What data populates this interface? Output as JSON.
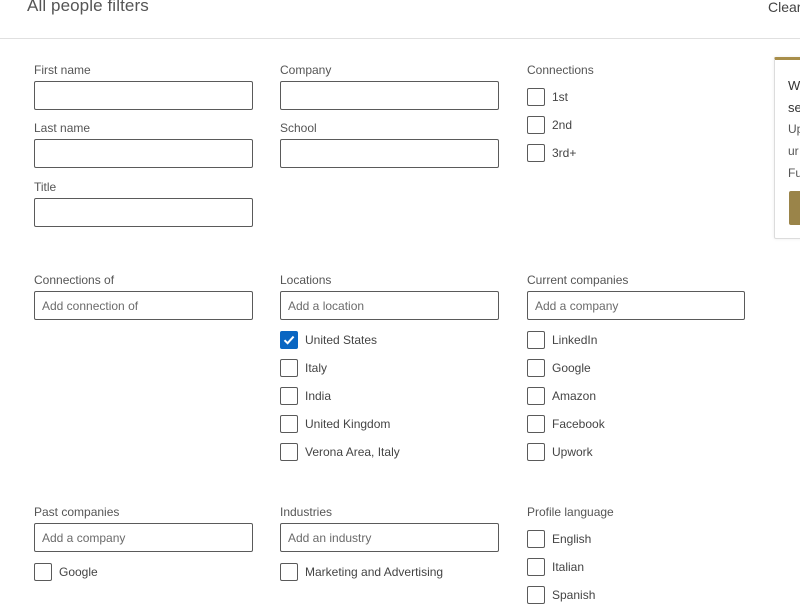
{
  "header": {
    "title": "All people filters",
    "clear_label": "Clear"
  },
  "fields": {
    "first_name": {
      "label": "First name",
      "value": ""
    },
    "last_name": {
      "label": "Last name",
      "value": ""
    },
    "title": {
      "label": "Title",
      "value": ""
    },
    "company": {
      "label": "Company",
      "value": ""
    },
    "school": {
      "label": "School",
      "value": ""
    }
  },
  "connections": {
    "label": "Connections",
    "options": [
      {
        "label": "1st",
        "checked": false
      },
      {
        "label": "2nd",
        "checked": false
      },
      {
        "label": "3rd+",
        "checked": false
      }
    ]
  },
  "connections_of": {
    "label": "Connections of",
    "placeholder": "Add connection of"
  },
  "locations": {
    "label": "Locations",
    "placeholder": "Add a location",
    "options": [
      {
        "label": "United States",
        "checked": true
      },
      {
        "label": "Italy",
        "checked": false
      },
      {
        "label": "India",
        "checked": false
      },
      {
        "label": "United Kingdom",
        "checked": false
      },
      {
        "label": "Verona Area, Italy",
        "checked": false
      }
    ]
  },
  "current_companies": {
    "label": "Current companies",
    "placeholder": "Add a company",
    "options": [
      {
        "label": "LinkedIn",
        "checked": false
      },
      {
        "label": "Google",
        "checked": false
      },
      {
        "label": "Amazon",
        "checked": false
      },
      {
        "label": "Facebook",
        "checked": false
      },
      {
        "label": "Upwork",
        "checked": false
      }
    ]
  },
  "past_companies": {
    "label": "Past companies",
    "placeholder": "Add a company",
    "options": [
      {
        "label": "Google",
        "checked": false
      }
    ]
  },
  "industries": {
    "label": "Industries",
    "placeholder": "Add an industry",
    "options": [
      {
        "label": "Marketing and Advertising",
        "checked": false
      }
    ]
  },
  "profile_language": {
    "label": "Profile language",
    "options": [
      {
        "label": "English",
        "checked": false
      },
      {
        "label": "Italian",
        "checked": false
      },
      {
        "label": "Spanish",
        "checked": false
      }
    ]
  },
  "side_card": {
    "lines": [
      "W",
      "se",
      "Up",
      "ur",
      "Fu"
    ]
  },
  "colors": {
    "checkbox_checked": "#0a66c2",
    "premium_accent": "#a88e4a"
  }
}
